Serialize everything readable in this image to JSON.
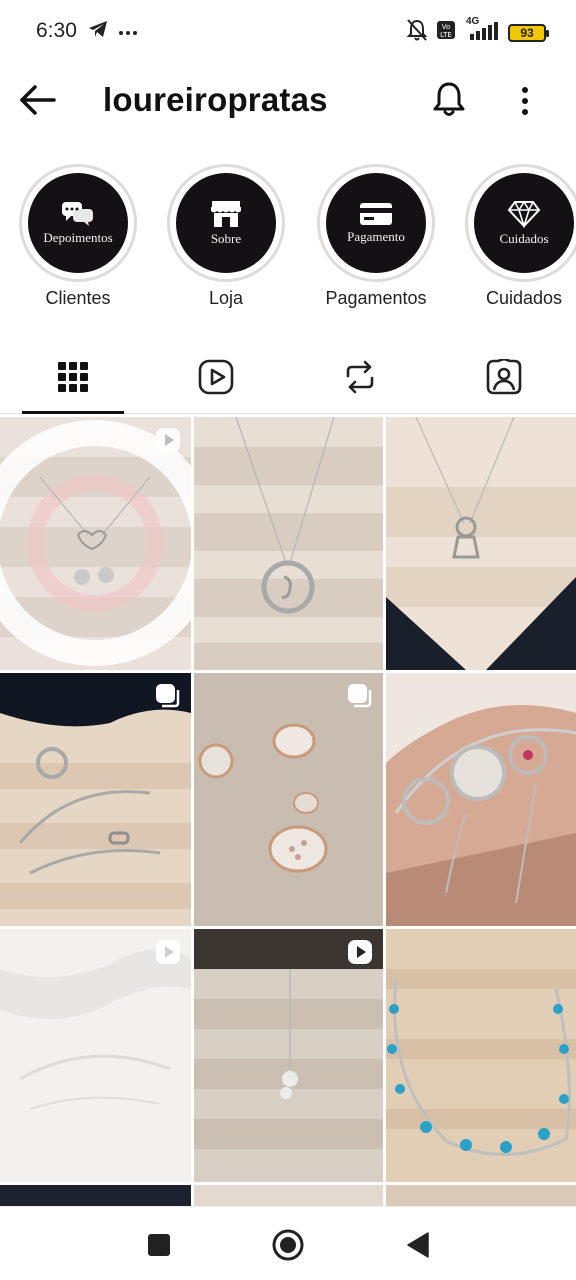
{
  "status_bar": {
    "time": "6:30",
    "left_icons": [
      "telegram-icon",
      "more-dots-icon"
    ],
    "right_icons": [
      "mute-icon",
      "volte-icon",
      "4g-signal-icon"
    ],
    "network_label": "4G",
    "battery": "93"
  },
  "header": {
    "username": "loureiropratas"
  },
  "highlights": [
    {
      "inner_text": "Depoimentos",
      "label": "Clientes",
      "icon": "chat-bubbles-icon"
    },
    {
      "inner_text": "Sobre",
      "label": "Loja",
      "icon": "store-icon"
    },
    {
      "inner_text": "Pagamento",
      "label": "Pagamentos",
      "icon": "credit-card-icon"
    },
    {
      "inner_text": "Cuidados",
      "label": "Cuidados",
      "icon": "diamond-icon"
    }
  ],
  "tabs": [
    {
      "name": "grid",
      "icon": "grid-icon",
      "active": true
    },
    {
      "name": "reels",
      "icon": "reels-icon",
      "active": false
    },
    {
      "name": "reposts",
      "icon": "repost-icon",
      "active": false
    },
    {
      "name": "tagged",
      "icon": "tagged-icon",
      "active": false
    }
  ],
  "posts": [
    {
      "subject": "heart necklace with two children pendants",
      "badge": "reel"
    },
    {
      "subject": "round letter pendant necklace",
      "badge": "none"
    },
    {
      "subject": "girl pendant necklace",
      "badge": "none"
    },
    {
      "subject": "ring and chain bracelet",
      "badge": "carousel"
    },
    {
      "subject": "oval stud earrings",
      "badge": "carousel"
    },
    {
      "subject": "flower bracelets on wrist",
      "badge": "none"
    },
    {
      "subject": "delicate bracelet on white fabric",
      "badge": "reel"
    },
    {
      "subject": "pendant necklace",
      "badge": "reel"
    },
    {
      "subject": "blue heart stone bracelet",
      "badge": "none"
    }
  ],
  "colors": {
    "highlight_bg": "#151013",
    "tab_indicator": "#111111",
    "battery_fill": "#f2c600"
  }
}
